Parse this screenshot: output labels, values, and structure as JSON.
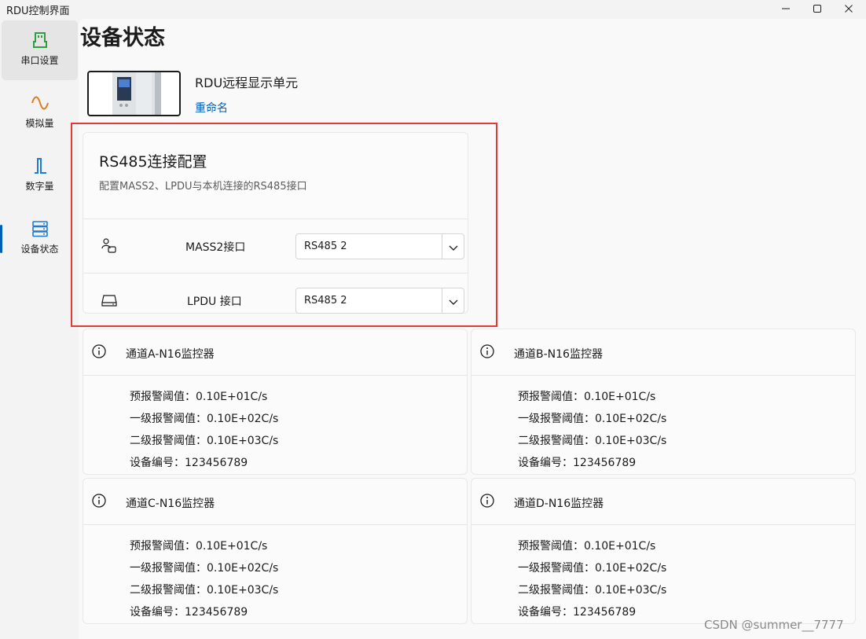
{
  "window": {
    "title": "RDU控制界面"
  },
  "sidebar": {
    "items": [
      {
        "label": "串口设置",
        "icon": "serial-port-icon",
        "active": true
      },
      {
        "label": "模拟量",
        "icon": "sine-wave-icon",
        "active": false
      },
      {
        "label": "数字量",
        "icon": "digital-signal-icon",
        "active": false
      },
      {
        "label": "设备状态",
        "icon": "server-stack-icon",
        "active": false
      }
    ]
  },
  "page": {
    "title": "设备状态",
    "device_name": "RDU远程显示单元",
    "rename_label": "重命名"
  },
  "config": {
    "title": "RS485连接配置",
    "subtitle": "配置MASS2、LPDU与本机连接的RS485接口",
    "rows": [
      {
        "label": "MASS2接口",
        "icon": "people-device-icon",
        "value": "RS485 2"
      },
      {
        "label": "LPDU 接口",
        "icon": "drive-icon",
        "value": "RS485 2"
      }
    ]
  },
  "monitors": [
    {
      "title": "通道A-N16监控器",
      "lines": [
        "预报警阈值：0.10E+01C/s",
        "一级报警阈值：0.10E+02C/s",
        "二级报警阈值：0.10E+03C/s",
        "设备编号：123456789"
      ]
    },
    {
      "title": "通道B-N16监控器",
      "lines": [
        "预报警阈值：0.10E+01C/s",
        "一级报警阈值：0.10E+02C/s",
        "二级报警阈值：0.10E+03C/s",
        "设备编号：123456789"
      ]
    },
    {
      "title": "通道C-N16监控器",
      "lines": [
        "预报警阈值：0.10E+01C/s",
        "一级报警阈值：0.10E+02C/s",
        "二级报警阈值：0.10E+03C/s",
        "设备编号：123456789"
      ]
    },
    {
      "title": "通道D-N16监控器",
      "lines": [
        "预报警阈值：0.10E+01C/s",
        "一级报警阈值：0.10E+02C/s",
        "二级报警阈值：0.10E+03C/s",
        "设备编号：123456789"
      ]
    }
  ],
  "watermark": "CSDN @summer__7777",
  "colors": {
    "accent": "#005fb8",
    "highlight": "#e53935",
    "serial_icon": "#2e9e3e",
    "analog_icon": "#e07a1f",
    "digital_icon": "#1f7ad6",
    "status_icon": "#1f7ad6"
  }
}
